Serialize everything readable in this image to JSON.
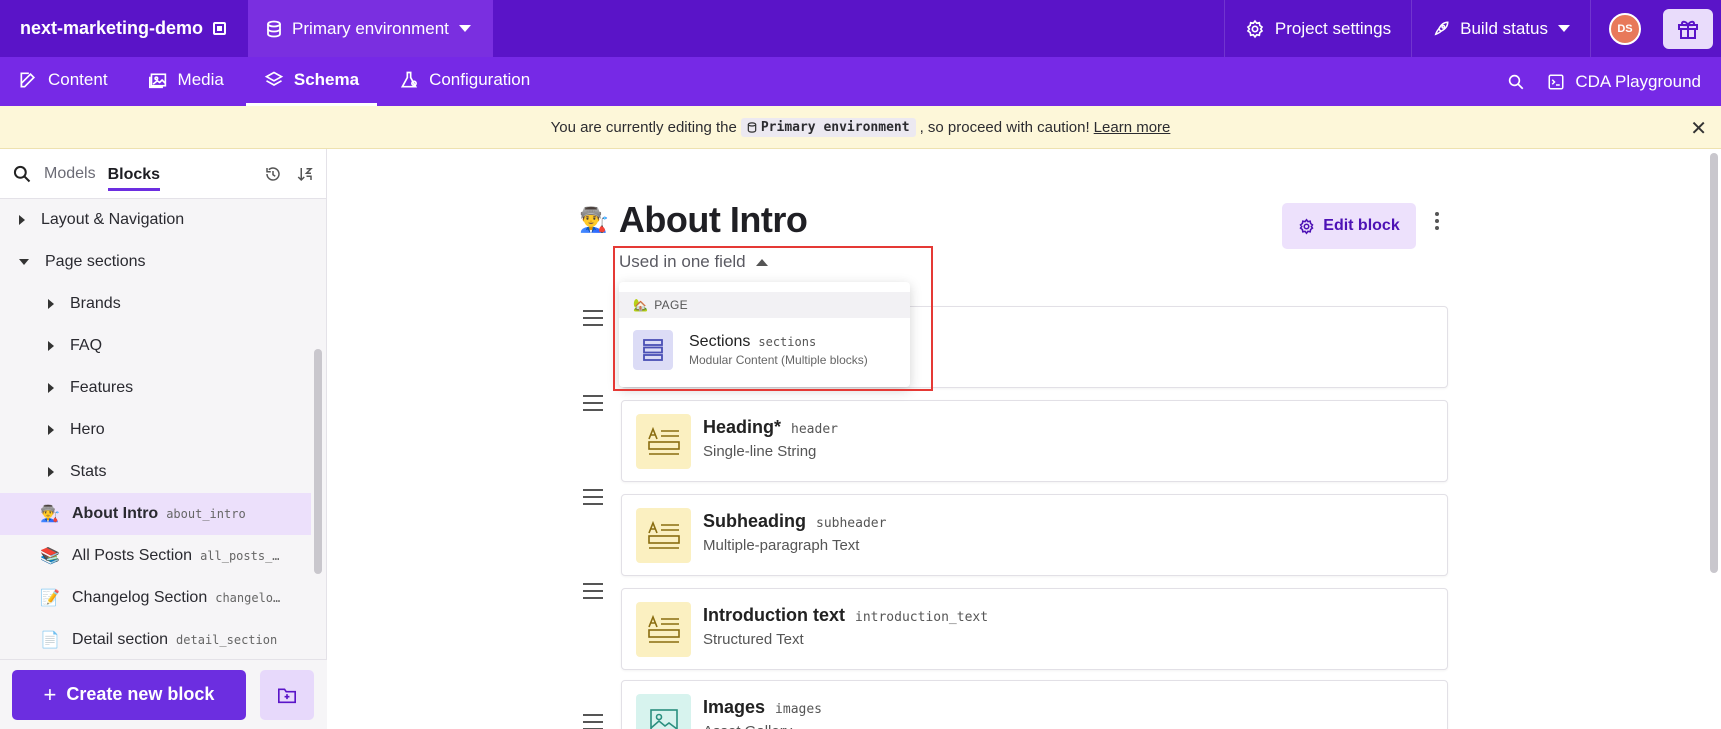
{
  "topbar": {
    "project_name": "next-marketing-demo",
    "environment": "Primary environment",
    "project_settings": "Project settings",
    "build_status": "Build status",
    "avatar_initials": "DS"
  },
  "nav": {
    "tabs": [
      {
        "label": "Content",
        "icon": "edit-icon"
      },
      {
        "label": "Media",
        "icon": "image-icon"
      },
      {
        "label": "Schema",
        "icon": "layers-icon",
        "active": true
      },
      {
        "label": "Configuration",
        "icon": "flask-icon"
      }
    ],
    "cda_playground": "CDA Playground"
  },
  "banner": {
    "prefix": "You are currently editing the",
    "env_tag": "Primary environment",
    "suffix": ", so proceed with caution!",
    "learn_more": "Learn more"
  },
  "sidebar": {
    "tabs": [
      "Models",
      "Blocks"
    ],
    "active_tab": "Blocks",
    "tree": [
      {
        "label": "Layout & Navigation",
        "level": 0,
        "expanded": false
      },
      {
        "label": "Page sections",
        "level": 0,
        "expanded": true
      },
      {
        "label": "Brands",
        "level": 1
      },
      {
        "label": "FAQ",
        "level": 1
      },
      {
        "label": "Features",
        "level": 1
      },
      {
        "label": "Hero",
        "level": 1
      },
      {
        "label": "Stats",
        "level": 1
      }
    ],
    "blocks": [
      {
        "emoji": "👨‍🏭",
        "label": "About Intro",
        "api": "about_intro",
        "selected": true
      },
      {
        "emoji": "📚",
        "label": "All Posts Section",
        "api": "all_posts_…"
      },
      {
        "emoji": "📝",
        "label": "Changelog Section",
        "api": "changelo…"
      },
      {
        "emoji": "📄",
        "label": "Detail section",
        "api": "detail_section"
      }
    ],
    "create_button": "Create new block"
  },
  "main": {
    "title_emoji": "👨‍🏭",
    "title": "About Intro",
    "edit_button": "Edit block",
    "used_in": "Used in one field",
    "popover": {
      "header_emoji": "🏡",
      "header": "PAGE",
      "item_name": "Sections",
      "item_api": "sections",
      "item_type": "Modular Content (Multiple blocks)"
    },
    "fields": [
      {
        "name": "",
        "api": "",
        "type": ""
      },
      {
        "name": "Heading*",
        "api": "header",
        "type": "Single-line String"
      },
      {
        "name": "Subheading",
        "api": "subheader",
        "type": "Multiple-paragraph Text"
      },
      {
        "name": "Introduction text",
        "api": "introduction_text",
        "type": "Structured Text"
      },
      {
        "name": "Images",
        "api": "images",
        "type": "Asset Gallery"
      }
    ]
  },
  "colors": {
    "topbar": "#5a14c8",
    "nav": "#7629e6",
    "accent": "#6c2ee0",
    "banner": "#fdf7d9",
    "highlight_box": "#e53935"
  }
}
